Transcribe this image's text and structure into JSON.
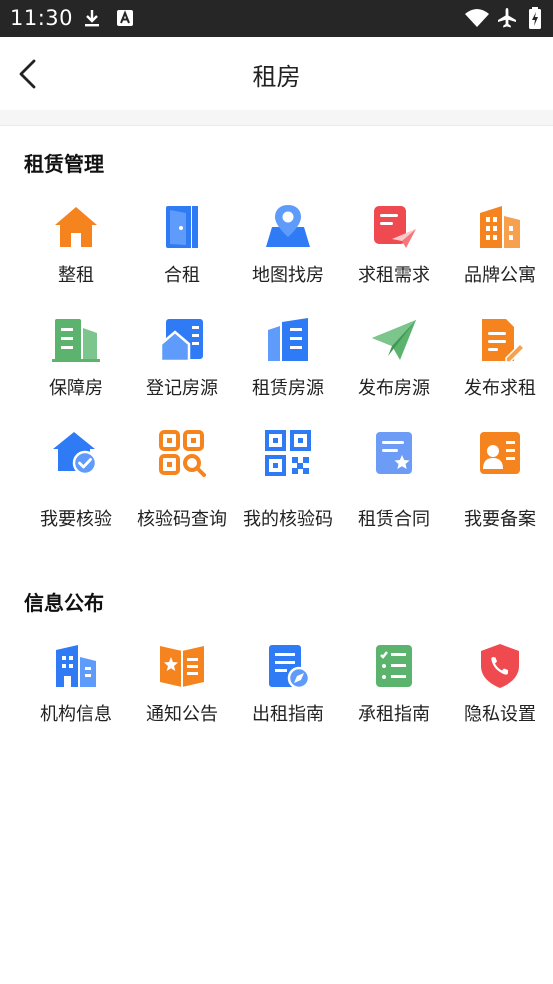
{
  "status_bar": {
    "time": "11:30",
    "icons": [
      "download-icon",
      "font-icon",
      "wifi-icon",
      "airplane-icon",
      "battery-charging-icon"
    ]
  },
  "nav": {
    "title": "租房",
    "back_icon": "chevron-left-icon"
  },
  "sections": [
    {
      "title": "租赁管理",
      "items": [
        {
          "label": "整租",
          "icon": "house-icon",
          "color": "#F5841F"
        },
        {
          "label": "合租",
          "icon": "door-icon",
          "color": "#2F7BF5"
        },
        {
          "label": "地图找房",
          "icon": "map-pin-icon",
          "color": "#2F7BF5"
        },
        {
          "label": "求租需求",
          "icon": "paper-plane-doc-icon",
          "color": "#EF4A4F"
        },
        {
          "label": "品牌公寓",
          "icon": "apartment-icon",
          "color": "#F5841F"
        },
        {
          "label": "保障房",
          "icon": "building-icon",
          "color": "#5BB36E"
        },
        {
          "label": "登记房源",
          "icon": "house-register-icon",
          "color": "#2F7BF5"
        },
        {
          "label": "租赁房源",
          "icon": "towers-icon",
          "color": "#2F7BF5"
        },
        {
          "label": "发布房源",
          "icon": "send-icon",
          "color": "#5BB36E"
        },
        {
          "label": "发布求租",
          "icon": "edit-doc-icon",
          "color": "#F5841F"
        },
        {
          "label": "我要核验",
          "icon": "house-check-icon",
          "color": "#2F7BF5"
        },
        {
          "label": "核验码查询",
          "icon": "qr-search-icon",
          "color": "#F5841F"
        },
        {
          "label": "我的核验码",
          "icon": "qr-code-icon",
          "color": "#2F7BF5"
        },
        {
          "label": "租赁合同",
          "icon": "contract-icon",
          "color": "#6C9CF5"
        },
        {
          "label": "我要备案",
          "icon": "user-card-icon",
          "color": "#F5841F"
        }
      ]
    },
    {
      "title": "信息公布",
      "items": [
        {
          "label": "机构信息",
          "icon": "organization-icon",
          "color": "#2F7BF5"
        },
        {
          "label": "通知公告",
          "icon": "notice-book-icon",
          "color": "#F5841F"
        },
        {
          "label": "出租指南",
          "icon": "guide-compass-icon",
          "color": "#2F7BF5"
        },
        {
          "label": "承租指南",
          "icon": "checklist-icon",
          "color": "#5BB36E"
        },
        {
          "label": "隐私设置",
          "icon": "shield-phone-icon",
          "color": "#EF4A4F"
        }
      ]
    }
  ]
}
